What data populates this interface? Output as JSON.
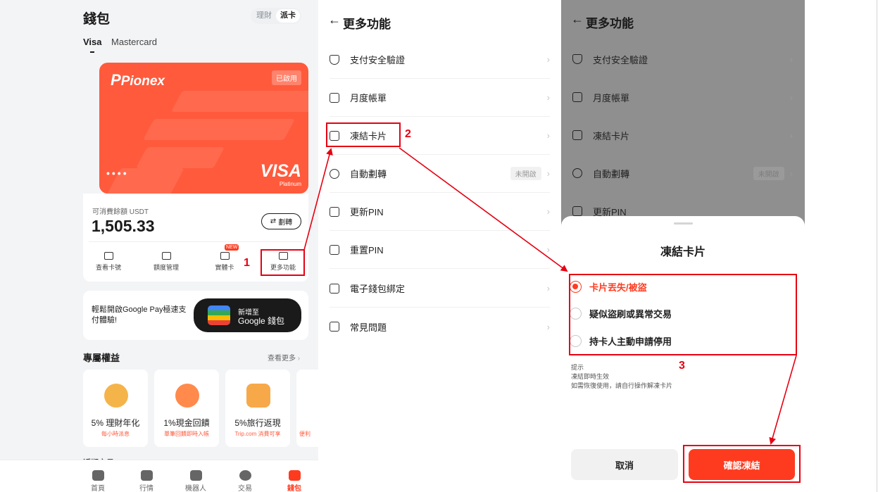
{
  "wallet": {
    "title": "錢包",
    "segment": [
      "理財",
      "派卡"
    ],
    "card_tabs": [
      "Visa",
      "Mastercard"
    ],
    "card": {
      "logo": "Pionex",
      "status": "已啟用",
      "dots": "••••",
      "brand": "VISA",
      "tier": "Platinum"
    },
    "balance_label": "可消費餘額 USDT",
    "balance_value": "1,505.33",
    "transfer_label": "劃轉",
    "actions": [
      "查看卡號",
      "額度管理",
      "實體卡",
      "更多功能"
    ],
    "new_badge": "NEW",
    "gpay_text": "輕鬆開啟Google Pay極速支付體驗!",
    "gpay_btn_line1": "新增至",
    "gpay_btn_line2": "Google 錢包",
    "benefits_title": "專屬權益",
    "see_more": "查看更多",
    "benefits": [
      {
        "title": "5% 理財年化",
        "sub": "每小時派息"
      },
      {
        "title": "1%現金回饋",
        "sub": "單筆回饋即時入帳"
      },
      {
        "title": "5%旅行返現",
        "sub": "Trip.com 消費可享"
      },
      {
        "title": "",
        "sub": "便利"
      }
    ],
    "recent_peek": "近期交易",
    "nav": [
      "首頁",
      "行情",
      "機器人",
      "交易",
      "錢包"
    ]
  },
  "more": {
    "back": "←",
    "title": "更多功能",
    "items": [
      {
        "label": "支付安全驗證",
        "badge": ""
      },
      {
        "label": "月度帳單",
        "badge": ""
      },
      {
        "label": "凍結卡片",
        "badge": ""
      },
      {
        "label": "自動劃轉",
        "badge": "未開啟"
      },
      {
        "label": "更新PIN",
        "badge": ""
      },
      {
        "label": "重置PIN",
        "badge": ""
      },
      {
        "label": "電子錢包綁定",
        "badge": ""
      },
      {
        "label": "常見問題",
        "badge": ""
      }
    ],
    "chevron": "›"
  },
  "freeze": {
    "title": "凍結卡片",
    "options": [
      "卡片丟失/被盜",
      "疑似盜刷或異常交易",
      "持卡人主動申請停用"
    ],
    "tips_title": "提示",
    "tips_line1": "凍結即時生效",
    "tips_line2": "如需恢復使用，請自行操作解凍卡片",
    "cancel": "取消",
    "confirm": "確認凍結"
  },
  "annotations": {
    "step1": "1",
    "step2": "2",
    "step3": "3",
    "color": "#e60012"
  },
  "colors": {
    "accent": "#ff3b1f",
    "card": "#ff5a3c"
  }
}
